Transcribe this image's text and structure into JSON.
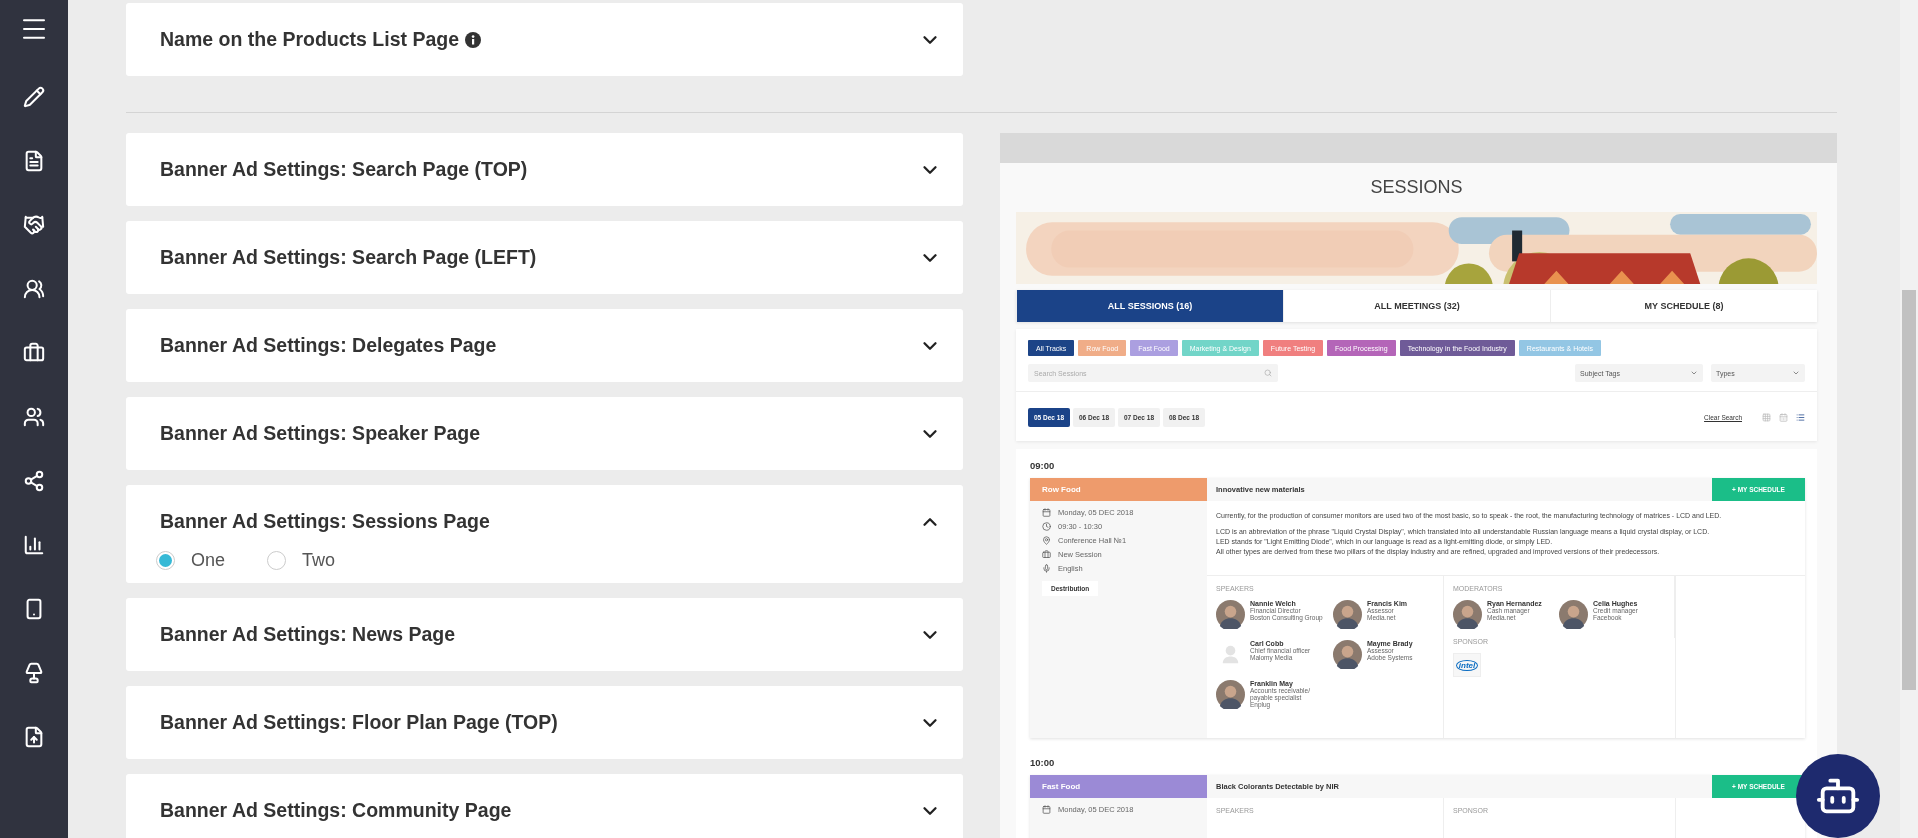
{
  "name_section": {
    "title": "Name on the Products List Page",
    "info": true,
    "expanded": false
  },
  "banner_settings": [
    {
      "title": "Banner Ad Settings: Search Page (TOP)",
      "expanded": false
    },
    {
      "title": "Banner Ad Settings: Search Page (LEFT)",
      "expanded": false
    },
    {
      "title": "Banner Ad Settings: Delegates Page",
      "expanded": false
    },
    {
      "title": "Banner Ad Settings: Speaker Page",
      "expanded": false
    },
    {
      "title": "Banner Ad Settings: Sessions Page",
      "expanded": true,
      "options": [
        {
          "label": "One",
          "selected": true
        },
        {
          "label": "Two",
          "selected": false
        }
      ]
    },
    {
      "title": "Banner Ad Settings: News Page",
      "expanded": false
    },
    {
      "title": "Banner Ad Settings: Floor Plan Page (TOP)",
      "expanded": false
    },
    {
      "title": "Banner Ad Settings: Community Page",
      "expanded": false
    }
  ],
  "preview": {
    "title": "SESSIONS",
    "tabs": [
      {
        "label": "ALL SESSIONS (16)",
        "selected": true
      },
      {
        "label": "ALL MEETINGS (32)",
        "selected": false
      },
      {
        "label": "MY SCHEDULE (8)",
        "selected": false
      }
    ],
    "tracks": [
      {
        "label": "All Tracks",
        "color": "#1d4487"
      },
      {
        "label": "Row Food",
        "color": "#f0ad88"
      },
      {
        "label": "Fast Food",
        "color": "#ab9fe0"
      },
      {
        "label": "Marketing & Design",
        "color": "#72d5c8"
      },
      {
        "label": "Future Testing",
        "color": "#f07f7f"
      },
      {
        "label": "Food Processing",
        "color": "#b465b8"
      },
      {
        "label": "Technology in the Food Industry",
        "color": "#6f5b98"
      },
      {
        "label": "Restaurants & Hotels",
        "color": "#93c6e4"
      }
    ],
    "search": {
      "placeholder": "Search Sessions"
    },
    "filters": [
      {
        "placeholder": "Subject Tags"
      },
      {
        "placeholder": "Types"
      }
    ],
    "dates": [
      {
        "label": "05 Dec 18",
        "selected": true
      },
      {
        "label": "06 Dec 18",
        "selected": false
      },
      {
        "label": "07 Dec 18",
        "selected": false
      },
      {
        "label": "08 Dec 18",
        "selected": false
      }
    ],
    "clear_search": "Clear Search",
    "views": [
      {
        "kind": "grid",
        "selected": false
      },
      {
        "kind": "calendar",
        "selected": false
      },
      {
        "kind": "list",
        "selected": true
      }
    ],
    "sessions": [
      {
        "time": "09:00",
        "track": "Row Food",
        "color": "#ee9b6c",
        "title": "Innovative new materials",
        "button": "+ MY SCHEDULE",
        "details": [
          {
            "kind": "date",
            "text": "Monday, 05 DEC 2018"
          },
          {
            "kind": "time",
            "text": "09:30 - 10:30"
          },
          {
            "kind": "place",
            "text": "Conference Hall №1"
          },
          {
            "kind": "type",
            "text": "New Session"
          },
          {
            "kind": "language",
            "text": "English"
          }
        ],
        "tag": "Destribution",
        "description": [
          [
            "Currently, for the production of consumer monitors are used two of the most basic, so to speak - the root, the manufacturing technology of matrices - LCD and LED."
          ],
          [
            "LCD is an abbreviation of the phrase \"Liquid Crystal Display\", which translated into all understandable Russian language means a liquid crystal display, or LCD.",
            "LED stands for \"Light Emitting Diode\", which in our language is read as a light-emitting diode, or simply LED.",
            "All other types are derived from these two pillars of the display industry and are refined, upgraded and improved versions of their predecessors."
          ]
        ],
        "speakers": {
          "heading": "SPEAKERS",
          "people": [
            {
              "name": "Nannie Welch",
              "role": "Financial Director",
              "company": "Boston Consulting Group"
            },
            {
              "name": "Francis Kim",
              "role": "Assessor",
              "company": "Media.net"
            },
            {
              "name": "Carl Cobb",
              "role": "Chief financial officer",
              "company": "Malomy Media",
              "kind": "placeholder"
            },
            {
              "name": "Mayme Brady",
              "role": "Assessor",
              "company": "Adobe Systems"
            },
            {
              "name": "Franklin May",
              "role": "Accounts receivable/ payable specialist",
              "company": "Enplug"
            }
          ]
        },
        "moderators": {
          "heading": "MODERATORS",
          "people": [
            {
              "name": "Ryan Hernandez",
              "role": "Cash manager",
              "company": "Media.net"
            },
            {
              "name": "Celia Hughes",
              "role": "Credit manager",
              "company": "Facebook"
            }
          ]
        },
        "sponsor": {
          "heading": "SPONSOR",
          "logo": "intel"
        }
      },
      {
        "time": "10:00",
        "track": "Fast Food",
        "color": "#9b8ad6",
        "title": "Black Colorants Detectable by NIR",
        "button": "+ MY SCHEDULE",
        "details": [
          {
            "kind": "date",
            "text": "Monday, 05 DEC 2018"
          }
        ],
        "speakers": {
          "heading": "SPEAKERS"
        },
        "sponsor": {
          "heading": "SPONSOR"
        }
      }
    ]
  }
}
